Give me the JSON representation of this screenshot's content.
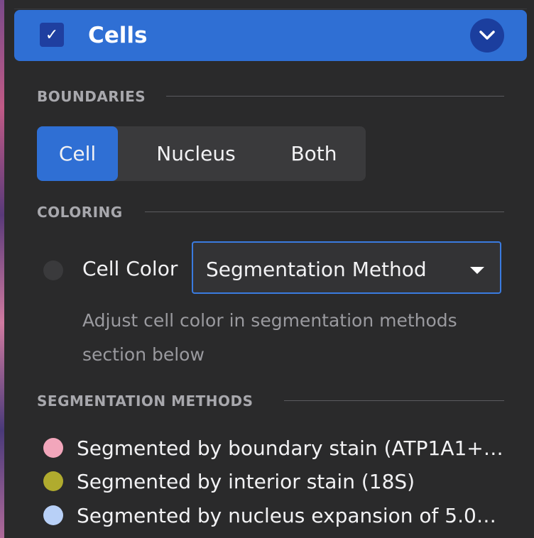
{
  "header": {
    "title": "Cells",
    "checked": true,
    "checkmark": "✓",
    "accent_color": "#2f6fd4"
  },
  "boundaries": {
    "heading": "BOUNDARIES",
    "options": [
      "Cell",
      "Nucleus",
      "Both"
    ],
    "selected": "Cell"
  },
  "coloring": {
    "heading": "COLORING",
    "label": "Cell Color",
    "select_value": "Segmentation Method",
    "hint": "Adjust cell color in segmentation methods section below"
  },
  "segmentation": {
    "heading": "SEGMENTATION METHODS",
    "items": [
      {
        "label": "Segmented by boundary stain (ATP1A1+…",
        "color": "#f2a6bb"
      },
      {
        "label": "Segmented by interior stain (18S)",
        "color": "#b0ab2e"
      },
      {
        "label": "Segmented by nucleus expansion of 5.0…",
        "color": "#b8d0f7"
      }
    ]
  }
}
